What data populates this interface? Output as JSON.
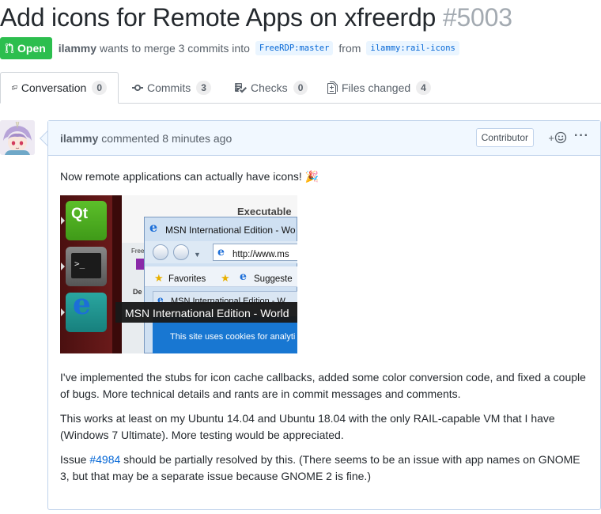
{
  "pr": {
    "title": "Add icons for Remote Apps on xfreerdp",
    "number": "#5003",
    "state": "Open",
    "author": "ilammy",
    "merge_text_1": "wants to merge 3 commits into",
    "base_branch": "FreeRDP:master",
    "merge_text_2": "from",
    "head_branch": "ilammy:rail-icons"
  },
  "tabs": [
    {
      "label": "Conversation",
      "count": "0",
      "icon": "comment-discussion-icon"
    },
    {
      "label": "Commits",
      "count": "3",
      "icon": "git-commit-icon"
    },
    {
      "label": "Checks",
      "count": "0",
      "icon": "checklist-icon"
    },
    {
      "label": "Files changed",
      "count": "4",
      "icon": "file-diff-icon"
    }
  ],
  "comment": {
    "author": "ilammy",
    "action": "commented 8 minutes ago",
    "badge": "Contributor",
    "reaction_label": "+",
    "more_label": "···",
    "intro": "Now remote applications can actually have icons! 🎉",
    "paragraph_1": "I've implemented the stubs for icon cache callbacks, added some color conversion code, and fixed a couple of bugs. More technical details and rants are in commit messages and comments.",
    "paragraph_2": "This works at least on my Ubuntu 14.04 and Ubuntu 18.04 with the only RAIL-capable VM that I have (Windows 7 Ultimate). More testing would be appreciated.",
    "issue_prefix": "Issue ",
    "issue_link": "#4984",
    "issue_suffix": " should be partially resolved by this. (There seems to be an issue with app names on GNOME 3, but that may be a separate issue because GNOME 2 is fine.)"
  },
  "screenshot": {
    "qt_label": "Qt",
    "terminal_prompt": ">_",
    "executable": "Executable",
    "free": "Free",
    "de": "De",
    "window_title": "MSN International Edition - Wo",
    "address": "http://www.ms",
    "favorites": "Favorites",
    "suggested": "Suggeste",
    "tab_title": "MSN International Edition - W",
    "tooltip": "MSN International Edition - World",
    "cookie_text": "This site uses cookies for analyti"
  },
  "colors": {
    "open_green": "#2cbe4e",
    "link_blue": "#0366d6",
    "header_bg": "#f1f8ff"
  }
}
